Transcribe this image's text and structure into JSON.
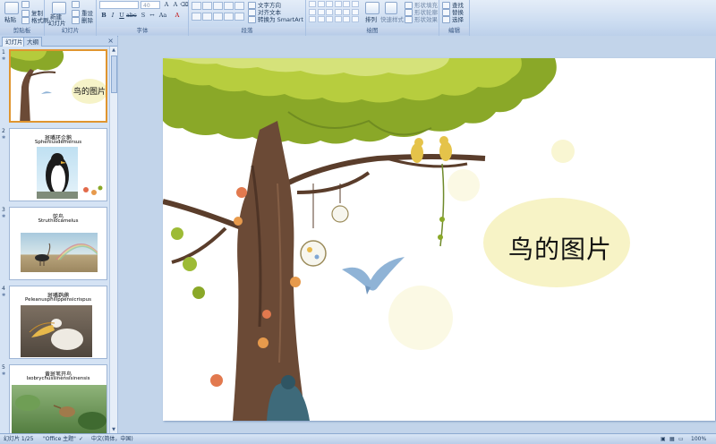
{
  "ribbon": {
    "clipboard": {
      "paste": "粘贴",
      "copy": "复制",
      "format_painter": "格式刷",
      "label": "剪贴板"
    },
    "slides": {
      "new_slide_1": "新建",
      "new_slide_2": "幻灯片",
      "reset": "重设",
      "delete": "删除",
      "label": "幻灯片"
    },
    "font": {
      "font_size": "40",
      "label": "字体",
      "bold": "B",
      "italic": "I",
      "underline": "U"
    },
    "paragraph": {
      "text_direction": "文字方向",
      "align_text": "对齐文本",
      "smartart": "转换为 SmartArt",
      "label": "段落"
    },
    "drawing": {
      "arrange": "排列",
      "quick_styles": "快速样式",
      "shape_fill": "形状填充",
      "shape_outline": "形状轮廓",
      "shape_effects": "形状效果",
      "label": "绘图"
    },
    "editing": {
      "find": "查找",
      "replace": "替换",
      "select": "选择",
      "label": "编辑"
    }
  },
  "left_pane": {
    "tabs": [
      "幻灯片",
      "大纲"
    ],
    "close": "×",
    "slides": [
      {
        "number": "1",
        "title": "鸟的图片",
        "subtitle": ""
      },
      {
        "number": "2",
        "title": "斑嘴环企鹅",
        "subtitle": "Spheniusdemersus"
      },
      {
        "number": "3",
        "title": "鸵鸟",
        "subtitle": "Struthiocamelus"
      },
      {
        "number": "4",
        "title": "斑嘴鹈鹕",
        "subtitle": "Peleanusphilippensicrispus"
      },
      {
        "number": "5",
        "title": "黄斑苇开鸟",
        "subtitle": "Ixobrychussinensisinensis"
      }
    ]
  },
  "slide": {
    "title": "鸟的图片"
  },
  "status_bar": {
    "slide_position": "幻灯片 1/25",
    "theme": "\"Office 主题\"",
    "language": "中文(简体，中国)",
    "zoom": "100%"
  },
  "colors": {
    "ribbon_bg": "#c9daf0",
    "pane_bg": "#d5e3f4",
    "work_bg": "#c2d4ea",
    "selected_border": "#e0952f",
    "foliage": "#8aa828",
    "trunk": "#6b4a36",
    "glow": "#f6f3c8",
    "bird_blue": "#8fb3d6"
  }
}
